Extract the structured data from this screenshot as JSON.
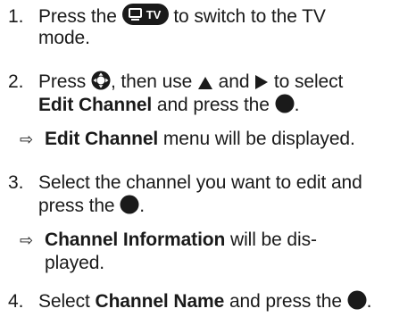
{
  "steps": [
    {
      "number": "1.",
      "pre": "Press the",
      "icon": "tv-button-icon",
      "icon_text": "TV",
      "post": "to switch to the TV",
      "line2": "mode."
    },
    {
      "number": "2.",
      "pre": "Press",
      "icon": "navigation-button-icon",
      "mid": ", then use",
      "up_icon": "up-triangle-icon",
      "and": "and",
      "right_icon": "right-triangle-icon",
      "post": "to select",
      "bold": "Edit Channel",
      "line2_post": "and press the",
      "ok_icon": "ok-button-icon",
      "end": ".",
      "result_arrow": "⇨",
      "result_bold": "Edit Channel",
      "result_text": "menu will be displayed."
    },
    {
      "number": "3.",
      "text": "Select the channel you want to edit and",
      "line2": "press the",
      "ok_icon": "ok-button-icon",
      "end": ".",
      "result_arrow": "⇨",
      "result_bold": "Channel Information",
      "result_text": "will be dis-",
      "result_line2": "played."
    },
    {
      "number": "4.",
      "pre": "Select",
      "bold": "Channel Name",
      "post": "and press the",
      "ok_icon": "ok-button-icon",
      "end": "."
    }
  ],
  "colors": {
    "text": "#1a1a1a",
    "icon_fill": "#1a1a1a",
    "icon_text": "#ffffff"
  }
}
